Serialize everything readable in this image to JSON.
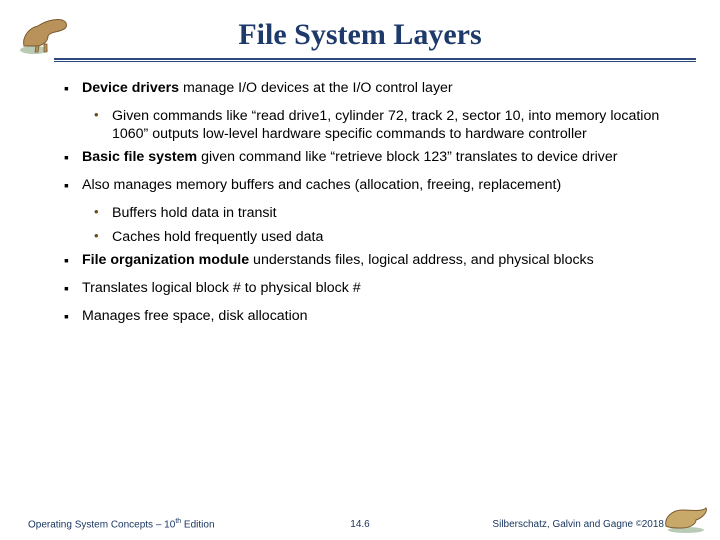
{
  "title": "File System Layers",
  "items": [
    {
      "bold": "Device drivers",
      "rest": " manage I/O devices at the I/O control layer",
      "sub": [
        "Given commands like “read drive1, cylinder 72, track 2, sector 10, into memory location 1060” outputs low-level hardware specific commands to hardware controller"
      ]
    },
    {
      "bold": "Basic file system",
      "rest": " given command like “retrieve block 123” translates to device driver"
    },
    {
      "rest": "Also manages memory buffers and caches (allocation, freeing, replacement)",
      "sub": [
        "Buffers hold data in transit",
        "Caches hold frequently used data"
      ]
    },
    {
      "bold": "File organization module",
      "rest": " understands files, logical address, and physical blocks"
    },
    {
      "rest": "Translates logical block # to physical block #"
    },
    {
      "rest": "Manages free space, disk allocation"
    }
  ],
  "footer": {
    "left_a": "Operating System Concepts – 10",
    "left_sup": "th",
    "left_b": " Edition",
    "center": "14.6",
    "right_a": "Silberschatz, Galvin and Gagne ",
    "right_c": "©",
    "right_b": "2018"
  }
}
